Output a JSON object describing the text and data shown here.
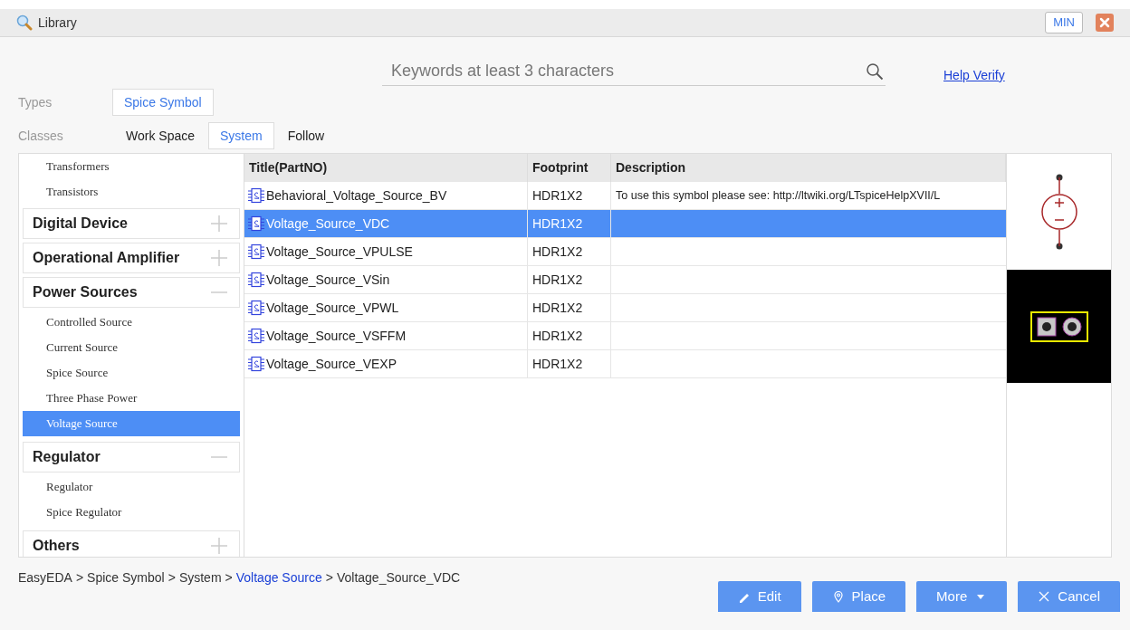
{
  "window": {
    "title": "Library",
    "min_button": "MIN"
  },
  "search": {
    "placeholder": "Keywords at least 3 characters"
  },
  "help_link": "Help Verify",
  "types": {
    "label": "Types",
    "options": [
      {
        "label": "Spice Symbol",
        "selected": true
      }
    ]
  },
  "classes": {
    "label": "Classes",
    "options": [
      {
        "label": "Work Space",
        "selected": false
      },
      {
        "label": "System",
        "selected": true
      },
      {
        "label": "Follow",
        "selected": false
      }
    ]
  },
  "tree": [
    {
      "kind": "leaf",
      "label": "Transformers",
      "selected": false
    },
    {
      "kind": "leaf",
      "label": "Transistors",
      "selected": false
    },
    {
      "kind": "group",
      "label": "Digital Device",
      "expanded": false
    },
    {
      "kind": "group",
      "label": "Operational Amplifier",
      "expanded": false
    },
    {
      "kind": "group",
      "label": "Power Sources",
      "expanded": true,
      "children": [
        {
          "label": "Controlled Source",
          "selected": false
        },
        {
          "label": "Current Source",
          "selected": false
        },
        {
          "label": "Spice Source",
          "selected": false
        },
        {
          "label": "Three Phase Power",
          "selected": false
        },
        {
          "label": "Voltage Source",
          "selected": true
        }
      ]
    },
    {
      "kind": "group",
      "label": "Regulator",
      "expanded": true,
      "children": [
        {
          "label": "Regulator",
          "selected": false
        },
        {
          "label": "Spice Regulator",
          "selected": false
        }
      ]
    },
    {
      "kind": "group",
      "label": "Others",
      "expanded": false
    }
  ],
  "table": {
    "columns": [
      "Title(PartNO)",
      "Footprint",
      "Description"
    ],
    "rows": [
      {
        "title": "Behavioral_Voltage_Source_BV",
        "footprint": "HDR1X2",
        "description": "To use this symbol please see: http://ltwiki.org/LTspiceHelpXVII/L",
        "selected": false
      },
      {
        "title": "Voltage_Source_VDC",
        "footprint": "HDR1X2",
        "selected": true
      },
      {
        "title": "Voltage_Source_VPULSE",
        "footprint": "HDR1X2",
        "selected": false
      },
      {
        "title": "Voltage_Source_VSin",
        "footprint": "HDR1X2",
        "selected": false
      },
      {
        "title": "Voltage_Source_VPWL",
        "footprint": "HDR1X2",
        "selected": false
      },
      {
        "title": "Voltage_Source_VSFFM",
        "footprint": "HDR1X2",
        "selected": false
      },
      {
        "title": "Voltage_Source_VEXP",
        "footprint": "HDR1X2",
        "selected": false
      }
    ]
  },
  "breadcrumb": {
    "separator": ">",
    "items": [
      {
        "label": "EasyEDA",
        "link": false
      },
      {
        "label": "Spice Symbol",
        "link": false
      },
      {
        "label": "System",
        "link": false
      },
      {
        "label": "Voltage Source",
        "link": true
      },
      {
        "label": "Voltage_Source_VDC",
        "link": false
      }
    ]
  },
  "buttons": [
    {
      "kind": "edit",
      "label": "Edit"
    },
    {
      "kind": "place",
      "label": "Place"
    },
    {
      "kind": "more",
      "label": "More"
    },
    {
      "kind": "cancel",
      "label": "Cancel"
    }
  ]
}
